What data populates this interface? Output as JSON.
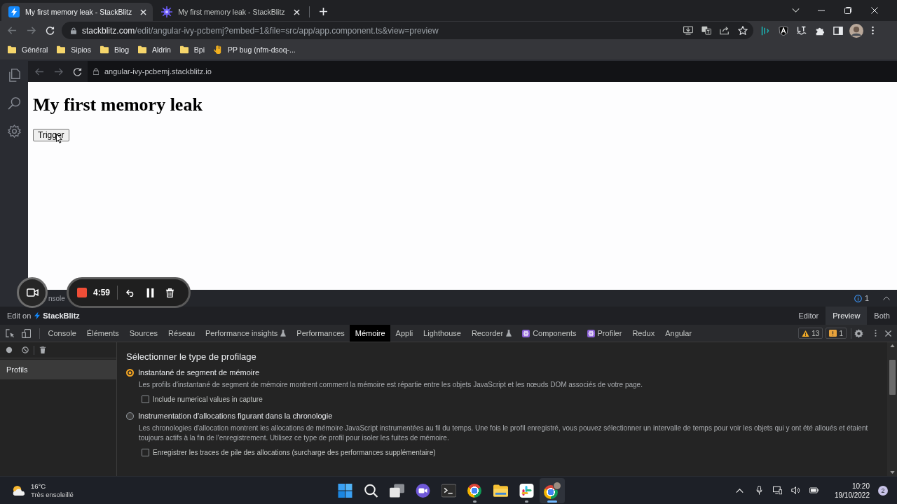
{
  "browser": {
    "tabs": [
      {
        "title": "My first memory leak - StackBlitz",
        "kind": "bolt",
        "selected": true
      },
      {
        "title": "My first memory leak - StackBlitz",
        "kind": "burst",
        "selected": false
      }
    ],
    "address": {
      "host": "stackblitz.com",
      "path": "/edit/angular-ivy-pcbemj?embed=1&file=src/app/app.component.ts&view=preview"
    },
    "bookmarks": [
      {
        "label": "Général",
        "kind": "folder"
      },
      {
        "label": "Sipios",
        "kind": "folder"
      },
      {
        "label": "Blog",
        "kind": "folder"
      },
      {
        "label": "Aldrin",
        "kind": "folder"
      },
      {
        "label": "Bpi",
        "kind": "folder"
      },
      {
        "label": "PP bug (nfm-dsoq-...",
        "kind": "page"
      }
    ]
  },
  "stackblitz": {
    "preview_url": "angular-ivy-pcbemj.stackblitz.io",
    "page": {
      "heading": "My first memory leak",
      "button": "Trigger"
    },
    "console_bar": {
      "label": "nsole",
      "info_count": "1"
    },
    "edit_on": "Edit on",
    "brand": "StackBlitz",
    "view_modes": [
      {
        "label": "Editor",
        "selected": false
      },
      {
        "label": "Preview",
        "selected": true
      },
      {
        "label": "Both",
        "selected": false
      }
    ]
  },
  "recorder": {
    "time": "4:59"
  },
  "devtools": {
    "tabs": [
      {
        "label": "Console",
        "kind": "plain",
        "selected": false
      },
      {
        "label": "Éléments",
        "kind": "plain",
        "selected": false
      },
      {
        "label": "Sources",
        "kind": "plain",
        "selected": false
      },
      {
        "label": "Réseau",
        "kind": "plain",
        "selected": false
      },
      {
        "label": "Performance insights",
        "kind": "experimental",
        "selected": false
      },
      {
        "label": "Performances",
        "kind": "plain",
        "selected": false
      },
      {
        "label": "Mémoire",
        "kind": "plain",
        "selected": true
      },
      {
        "label": "Appli",
        "kind": "plain",
        "selected": false
      },
      {
        "label": "Lighthouse",
        "kind": "plain",
        "selected": false
      },
      {
        "label": "Recorder",
        "kind": "experimental",
        "selected": false
      },
      {
        "label": "Components",
        "kind": "react",
        "selected": false
      },
      {
        "label": "Profiler",
        "kind": "react",
        "selected": false
      },
      {
        "label": "Redux",
        "kind": "plain",
        "selected": false
      },
      {
        "label": "Angular",
        "kind": "plain",
        "selected": false
      }
    ],
    "warnings": "13",
    "issues": "1",
    "sidebar": [
      {
        "label": "Profils",
        "selected": true
      }
    ],
    "panel": {
      "title": "Sélectionner le type de profilage",
      "options": [
        {
          "label": "Instantané de segment de mémoire",
          "selected": true,
          "description": "Les profils d'instantané de segment de mémoire montrent comment la mémoire est répartie entre les objets JavaScript et les nœuds DOM associés de votre page.",
          "checkbox": {
            "label": "Include numerical values in capture",
            "checked": false
          }
        },
        {
          "label": "Instrumentation d'allocations figurant dans la chronologie",
          "selected": false,
          "description": "Les chronologies d'allocation montrent les allocations de mémoire JavaScript instrumentées au fil du temps. Une fois le profil enregistré, vous pouvez sélectionner un intervalle de temps pour voir les objets qui y ont été alloués et étaient toujours actifs à la fin de l'enregistrement. Utilisez ce type de profil pour isoler les fuites de mémoire.",
          "checkbox": {
            "label": "Enregistrer les traces de pile des allocations (surcharge des performances supplémentaire)",
            "checked": false
          }
        }
      ]
    }
  },
  "taskbar": {
    "weather": {
      "temperature": "16°C",
      "condition": "Très ensoleillé"
    },
    "apps": [
      {
        "kind": "start",
        "running": false,
        "selected": false
      },
      {
        "kind": "search",
        "running": false,
        "selected": false
      },
      {
        "kind": "taskview",
        "running": false,
        "selected": false
      },
      {
        "kind": "chat",
        "running": false,
        "selected": false
      },
      {
        "kind": "terminal",
        "running": false,
        "selected": false
      },
      {
        "kind": "chrome",
        "running": true,
        "selected": false
      },
      {
        "kind": "folder",
        "running": false,
        "selected": false
      },
      {
        "kind": "slack",
        "running": true,
        "selected": false
      },
      {
        "kind": "chromeuser",
        "running": true,
        "selected": true
      }
    ],
    "clock": {
      "time": "10:20",
      "date": "19/10/2022"
    },
    "notifications": "2"
  }
}
